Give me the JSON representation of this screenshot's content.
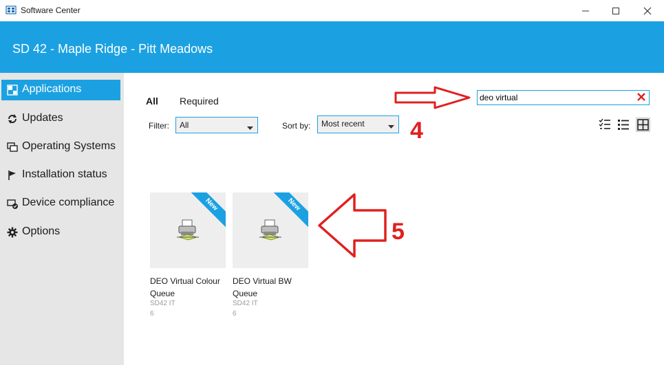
{
  "window": {
    "title": "Software Center",
    "icon": "software-center-icon"
  },
  "header": {
    "org_name": "SD 42 - Maple Ridge - Pitt Meadows"
  },
  "sidebar": {
    "items": [
      {
        "label": "Applications",
        "icon": "applications-icon",
        "active": true
      },
      {
        "label": "Updates",
        "icon": "updates-icon"
      },
      {
        "label": "Operating Systems",
        "icon": "operating-systems-icon"
      },
      {
        "label": "Installation status",
        "icon": "flag-icon"
      },
      {
        "label": "Device compliance",
        "icon": "compliance-icon"
      },
      {
        "label": "Options",
        "icon": "gear-icon"
      }
    ]
  },
  "main": {
    "tabs": [
      {
        "label": "All",
        "active": true
      },
      {
        "label": "Required"
      }
    ],
    "search": {
      "value": "deo virtual"
    },
    "filter": {
      "label": "Filter:",
      "value": "All"
    },
    "sort": {
      "label": "Sort by:",
      "value": "Most recent"
    },
    "apps": [
      {
        "name": "DEO Virtual Colour Queue",
        "publisher": "SD42 IT",
        "version": "6",
        "badge": "New"
      },
      {
        "name": "DEO Virtual BW Queue",
        "publisher": "SD42 IT",
        "version": "6",
        "badge": "New"
      }
    ]
  },
  "annotations": {
    "step4": "4",
    "step5": "5"
  },
  "colors": {
    "accent": "#1ba1e2",
    "sidebar_bg": "#e6e6e6",
    "annotation_red": "#e02020"
  }
}
